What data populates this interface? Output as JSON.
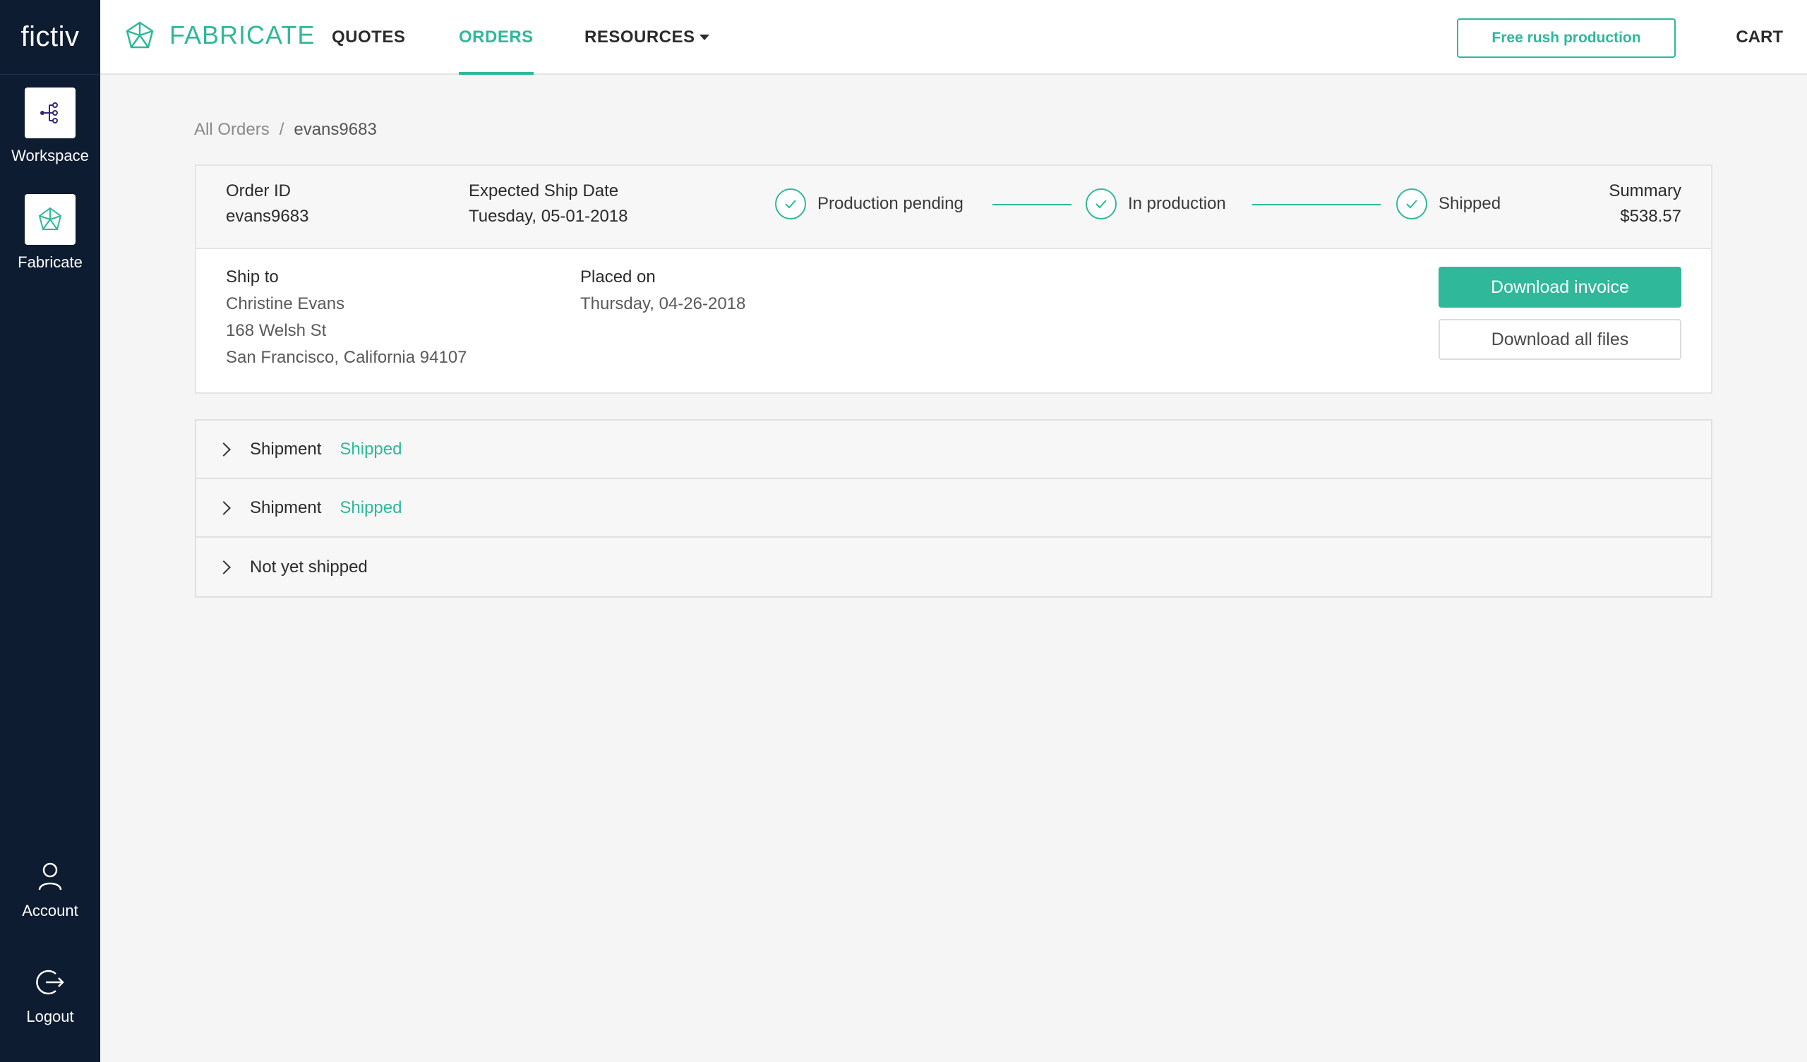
{
  "sidebar": {
    "brand": "fictiv",
    "items": [
      {
        "label": "Workspace",
        "icon": "workspace-tree-icon"
      },
      {
        "label": "Fabricate",
        "icon": "fabricate-network-icon"
      },
      {
        "label": "Account",
        "icon": "user-icon"
      },
      {
        "label": "Logout",
        "icon": "logout-icon"
      }
    ]
  },
  "header": {
    "logo_text": "FABRICATE",
    "nav": [
      {
        "label": "QUOTES",
        "active": false
      },
      {
        "label": "ORDERS",
        "active": true
      },
      {
        "label": "RESOURCES",
        "active": false,
        "has_dropdown": true
      }
    ],
    "rush_button": "Free rush production",
    "cart": "CART"
  },
  "breadcrumb": {
    "root": "All Orders",
    "separator": "/",
    "current": "evans9683"
  },
  "order": {
    "id_label": "Order ID",
    "id_value": "evans9683",
    "ship_date_label": "Expected Ship Date",
    "ship_date_value": "Tuesday, 05-01-2018",
    "steps": [
      {
        "label": "Production pending",
        "done": true
      },
      {
        "label": "In production",
        "done": true
      },
      {
        "label": "Shipped",
        "done": true
      }
    ],
    "summary_label": "Summary",
    "summary_value": "$538.57",
    "ship_to_label": "Ship to",
    "ship_to_lines": [
      "Christine Evans",
      "168 Welsh St",
      "San Francisco, California 94107"
    ],
    "placed_on_label": "Placed on",
    "placed_on_value": "Thursday, 04-26-2018",
    "download_invoice": "Download invoice",
    "download_files": "Download all files"
  },
  "shipments": [
    {
      "title": "Shipment",
      "status": "Shipped"
    },
    {
      "title": "Shipment",
      "status": "Shipped"
    },
    {
      "title": "Not yet shipped",
      "status": ""
    }
  ],
  "colors": {
    "accent": "#2fb89a",
    "sidebar_bg": "#0d1c31",
    "page_bg": "#f5f5f5"
  }
}
